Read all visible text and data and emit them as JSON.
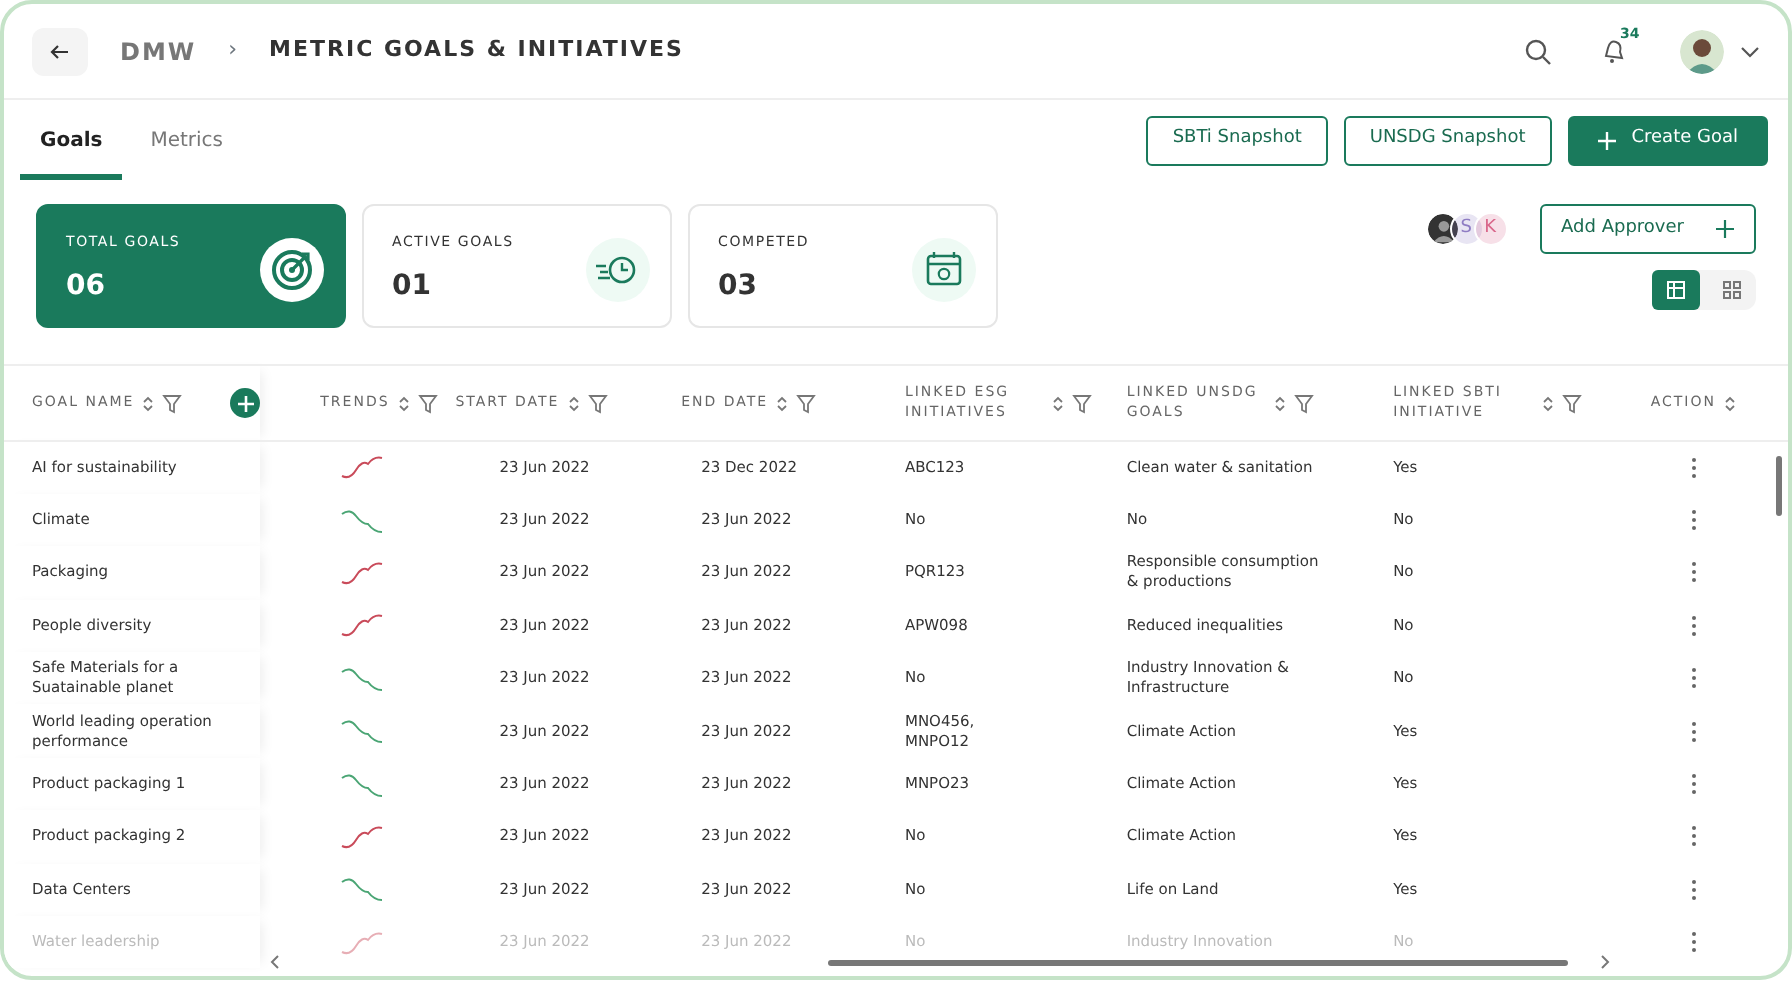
{
  "header": {
    "breadcrumb_root": "DMW",
    "breadcrumb_separator": "›",
    "title": "METRIC GOALS & INITIATIVES",
    "notification_count": "34"
  },
  "tabs": [
    {
      "label": "Goals",
      "selected": true
    },
    {
      "label": "Metrics",
      "selected": false
    }
  ],
  "actions": [
    {
      "label": "SBTi Snapshot",
      "kind": "outline"
    },
    {
      "label": "UNSDG Snapshot",
      "kind": "outline"
    },
    {
      "label": "Create Goal",
      "kind": "primary"
    }
  ],
  "summary_cards": [
    {
      "label": "TOTAL GOALS",
      "value": "06",
      "kind": "target",
      "selected": true
    },
    {
      "label": "ACTIVE GOALS",
      "value": "01",
      "kind": "clock",
      "selected": false
    },
    {
      "label": "COMPETED",
      "value": "03",
      "kind": "calendar",
      "selected": false
    }
  ],
  "approvers": [
    {
      "kind": "photo"
    },
    {
      "kind": "initial",
      "initial": "S",
      "color": "#8e7cc3"
    },
    {
      "kind": "initial",
      "initial": "K",
      "color": "#d9668a"
    }
  ],
  "add_approver": "Add Approver",
  "views": [
    {
      "kind": "table",
      "selected": true
    },
    {
      "kind": "grid",
      "selected": false
    }
  ],
  "table": {
    "columns": [
      {
        "label": "GOAL NAME",
        "filter": true
      },
      {
        "label": "TRENDS",
        "filter": true
      },
      {
        "label": "START DATE",
        "filter": true
      },
      {
        "label": "END DATE",
        "filter": true
      },
      {
        "label": "LINKED ESG INITIATIVES",
        "filter": true
      },
      {
        "label": "LINKED UNSDG GOALS",
        "filter": true
      },
      {
        "label": "LINKED SBTI INITIATIVE",
        "filter": true
      },
      {
        "label": "ACTION",
        "filter": false
      }
    ],
    "rows": [
      {
        "name": "AI for sustainability",
        "kind": "up",
        "start": "23 Jun 2022",
        "end": "23 Dec 2022",
        "esg": "ABC123",
        "unsdg": "Clean water & sanitation",
        "sbti": "Yes"
      },
      {
        "name": "Climate",
        "kind": "down",
        "start": "23 Jun 2022",
        "end": "23 Jun 2022",
        "esg": "No",
        "unsdg": "No",
        "sbti": "No"
      },
      {
        "name": "Packaging",
        "kind": "up",
        "start": "23 Jun 2022",
        "end": "23 Jun 2022",
        "esg": "PQR123",
        "unsdg": "Responsible consumption & productions",
        "sbti": "No"
      },
      {
        "name": "People diversity",
        "kind": "up",
        "start": "23 Jun 2022",
        "end": "23 Jun 2022",
        "esg": "APW098",
        "unsdg": "Reduced inequalities",
        "sbti": "No"
      },
      {
        "name": "Safe Materials for a Suatainable planet",
        "kind": "down",
        "start": "23 Jun 2022",
        "end": "23 Jun 2022",
        "esg": "No",
        "unsdg": "Industry Innovation & Infrastructure",
        "sbti": "No"
      },
      {
        "name": "World leading operation performance",
        "kind": "down",
        "start": "23 Jun 2022",
        "end": "23 Jun 2022",
        "esg": "MNO456, MNPO12",
        "unsdg": "Climate Action",
        "sbti": "Yes"
      },
      {
        "name": "Product packaging 1",
        "kind": "down",
        "start": "23 Jun 2022",
        "end": "23 Jun 2022",
        "esg": "MNPO23",
        "unsdg": "Climate Action",
        "sbti": "Yes"
      },
      {
        "name": "Product packaging 2",
        "kind": "up",
        "start": "23 Jun 2022",
        "end": "23 Jun 2022",
        "esg": "No",
        "unsdg": "Climate Action",
        "sbti": "Yes"
      },
      {
        "name": "Data Centers",
        "kind": "down",
        "start": "23 Jun 2022",
        "end": "23 Jun 2022",
        "esg": "No",
        "unsdg": "Life on Land",
        "sbti": "Yes"
      },
      {
        "name": "Water leadership",
        "kind": "up",
        "start": "23 Jun 2022",
        "end": "23 Jun 2022",
        "esg": "No",
        "unsdg": "Industry Innovation",
        "sbti": "No",
        "faded": true
      }
    ]
  }
}
